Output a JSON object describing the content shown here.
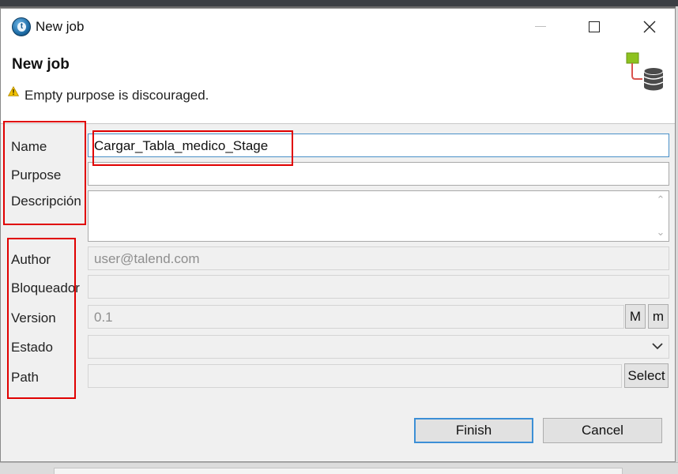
{
  "window": {
    "title": "New job"
  },
  "header": {
    "title": "New job",
    "warning": "Empty purpose is discouraged."
  },
  "form": {
    "name": {
      "label": "Name",
      "value": "Cargar_Tabla_medico_Stage"
    },
    "purpose": {
      "label": "Purpose",
      "value": ""
    },
    "description": {
      "label": "Descripción",
      "value": ""
    },
    "author": {
      "label": "Author",
      "value": "user@talend.com"
    },
    "locker": {
      "label": "Bloqueador",
      "value": ""
    },
    "version": {
      "label": "Version",
      "value": "0.1",
      "major_label": "M",
      "minor_label": "m"
    },
    "status": {
      "label": "Estado",
      "value": ""
    },
    "path": {
      "label": "Path",
      "value": "",
      "select_label": "Select"
    }
  },
  "buttons": {
    "finish": "Finish",
    "cancel": "Cancel"
  },
  "colors": {
    "highlight": "#e00000",
    "focus": "#4a90c8",
    "warning": "#f2c200",
    "wizard_green": "#8dc21f"
  },
  "icons": {
    "app": "talend-logo-icon",
    "warning": "warning-icon",
    "wizard": "job-database-icon"
  }
}
